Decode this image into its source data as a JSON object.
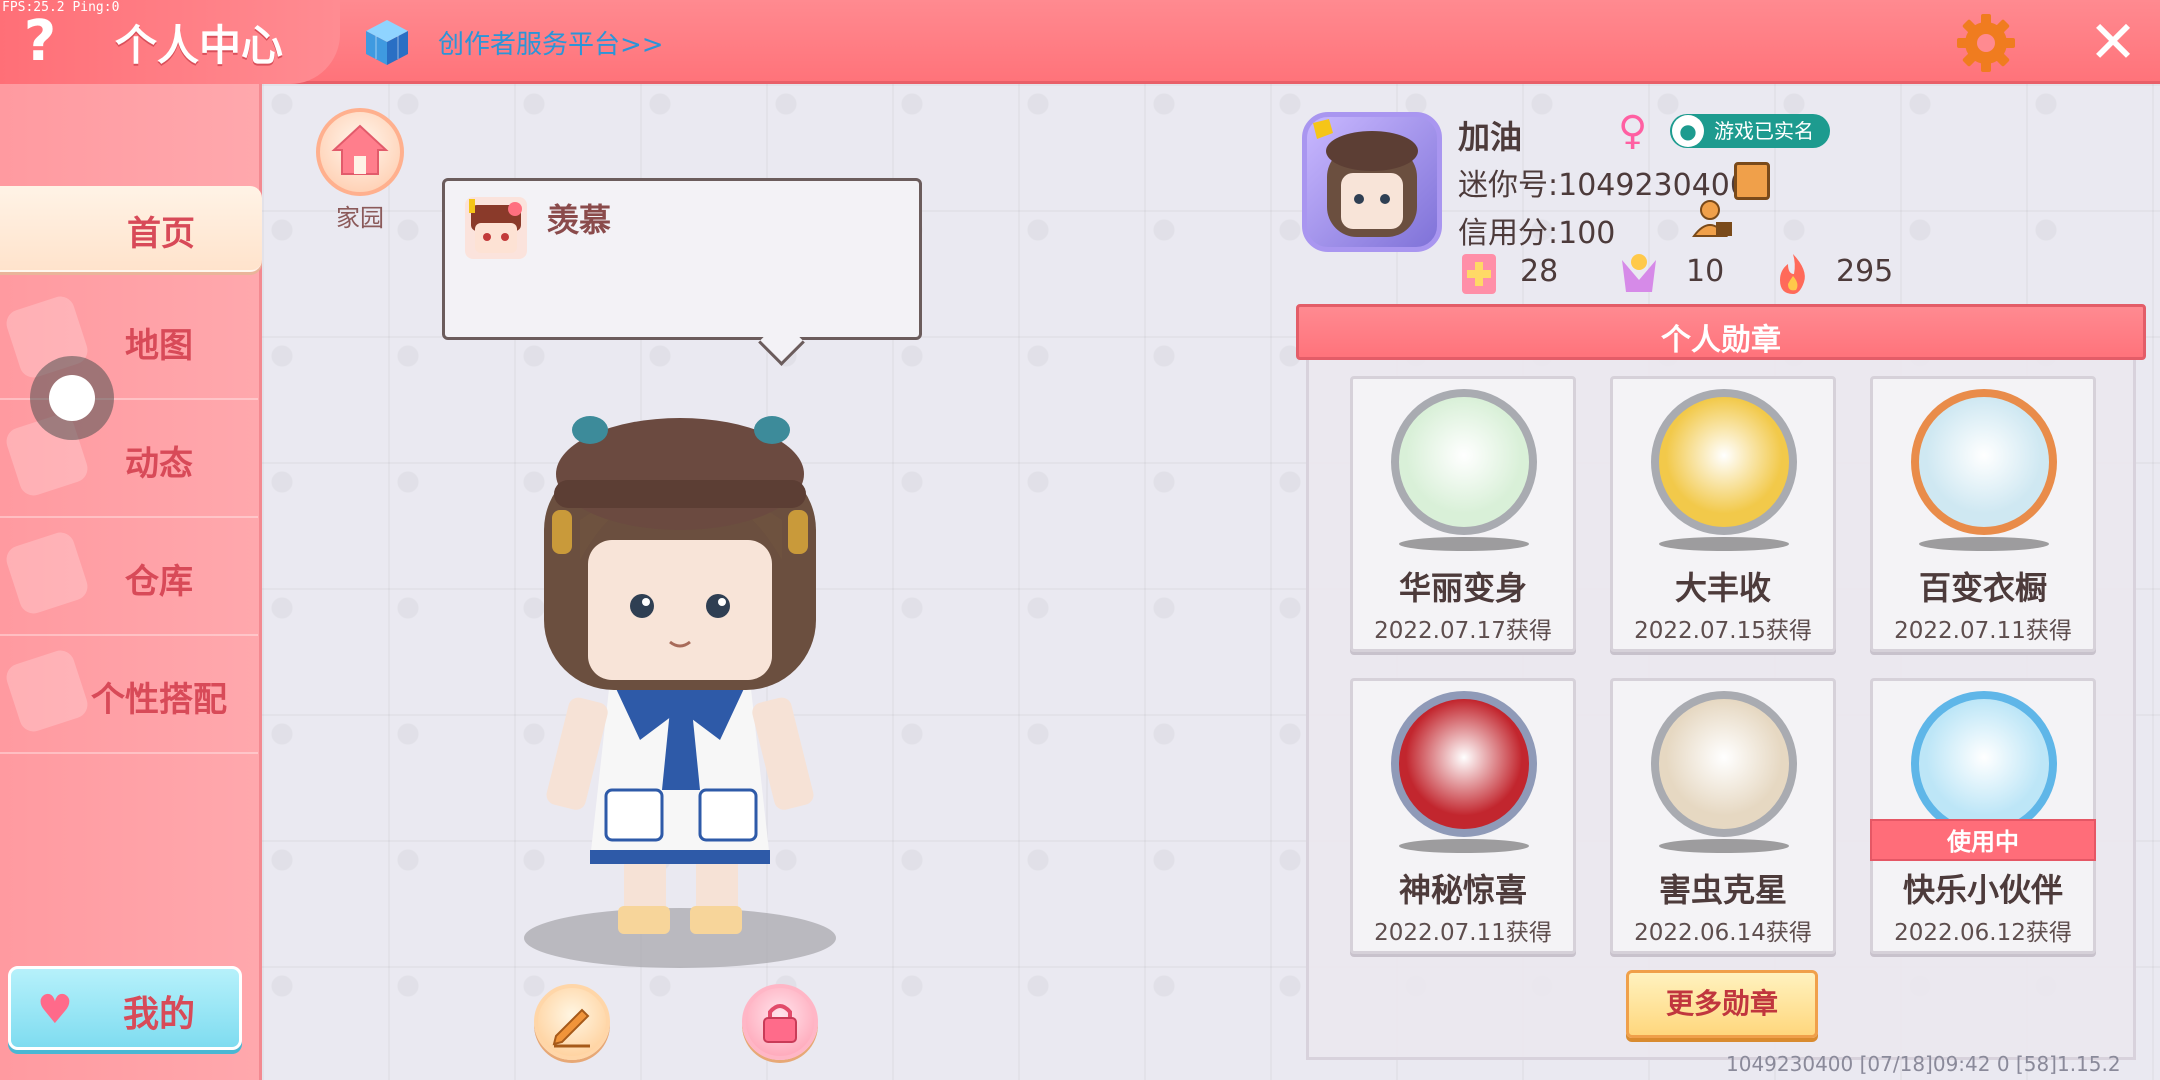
{
  "debug": {
    "fps_text": "FPS:25.2  Ping:0"
  },
  "header": {
    "help_label": "?",
    "title": "个人中心",
    "creator_link": "创作者服务平台>>",
    "close_label": "✕"
  },
  "sidebar": {
    "items": [
      {
        "label": "首页",
        "active": true
      },
      {
        "label": "地图",
        "active": false
      },
      {
        "label": "动态",
        "active": false
      },
      {
        "label": "仓库",
        "active": false
      },
      {
        "label": "个性搭配",
        "active": false
      }
    ],
    "my_button": "我的"
  },
  "home": {
    "label": "家园"
  },
  "bubble": {
    "text": "羡慕"
  },
  "profile": {
    "nickname": "加油",
    "gender": "♀",
    "realname_badge": "游戏已实名",
    "mini_id": "迷你号:1049230400",
    "credit": "信用分:100",
    "stats": [
      {
        "icon": "plus-card-icon",
        "value": "28"
      },
      {
        "icon": "trophy-person-icon",
        "value": "10"
      },
      {
        "icon": "flame-icon",
        "value": "295"
      }
    ]
  },
  "medals": {
    "title": "个人勋章",
    "items": [
      {
        "name": "华丽变身",
        "date": "2022.07.17获得",
        "rim": "#a9abb1",
        "fill": "#d9f0d8",
        "in_use": false
      },
      {
        "name": "大丰收",
        "date": "2022.07.15获得",
        "rim": "#a9abb1",
        "fill": "#f2c94a",
        "in_use": false
      },
      {
        "name": "百变衣橱",
        "date": "2022.07.11获得",
        "rim": "#e98c4a",
        "fill": "#cfe8f2",
        "in_use": false
      },
      {
        "name": "神秘惊喜",
        "date": "2022.07.11获得",
        "rim": "#8f9ab8",
        "fill": "#c2262e",
        "in_use": false
      },
      {
        "name": "害虫克星",
        "date": "2022.06.14获得",
        "rim": "#a9abb1",
        "fill": "#e6d8c2",
        "in_use": false
      },
      {
        "name": "快乐小伙伴",
        "date": "2022.06.12获得",
        "rim": "#5fb6e8",
        "fill": "#bde6f7",
        "in_use": true,
        "in_use_label": "使用中"
      }
    ],
    "more_button": "更多勋章"
  },
  "footer": {
    "info": "1049230400   [07/18]09:42 0   [58]1.15.2"
  },
  "colors": {
    "accent": "#ff7a82",
    "link": "#2b95d8",
    "in_use": "#ff6d79"
  }
}
